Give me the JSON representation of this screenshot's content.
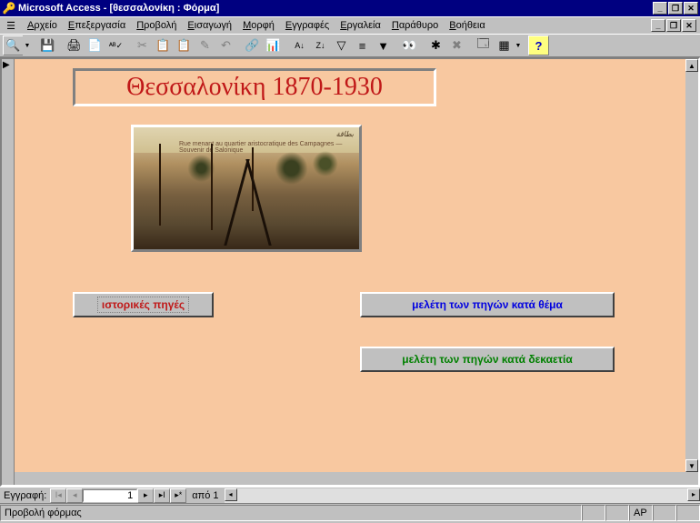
{
  "titlebar": {
    "app": "Microsoft Access",
    "doc": "[θεσσαλονίκη : Φόρμα]"
  },
  "menus": {
    "file": "Αρχείο",
    "edit": "Επεξεργασία",
    "view": "Προβολή",
    "insert": "Εισαγωγή",
    "format": "Μορφή",
    "records": "Εγγραφές",
    "tools": "Εργαλεία",
    "window": "Παράθυρο",
    "help": "Βοήθεια"
  },
  "form": {
    "heading": "Θεσσαλονίκη 1870-1930",
    "image_caption_top": "بطاقة",
    "image_caption_mid": "Rue menant au quartier aristocratique des Campagnes — Souvenir de Salonique",
    "btn_sources": "ιστορικές πηγές",
    "btn_theme": "μελέτη των πηγών κατά θέμα",
    "btn_decade": "μελέτη των πηγών κατά δεκαετία"
  },
  "recordnav": {
    "label": "Εγγραφή:",
    "current": "1",
    "of_text": "από 1"
  },
  "status": {
    "text": "Προβολή φόρμας",
    "indicator": "ΑΡ"
  },
  "icons": {
    "view": "🔍",
    "save": "💾",
    "print": "🖨",
    "preview": "📄",
    "spell": "ᴬᴮ✓",
    "cut": "✂",
    "copy": "📋",
    "paste": "📋",
    "fmt": "✎",
    "undo": "↶",
    "link": "🔗",
    "t1": "📊",
    "t2": "≡",
    "new": "✱",
    "del": "✖",
    "sort1": "A↓",
    "sort2": "Z↓",
    "filter1": "▽",
    "filter2": "▼",
    "find": "👀",
    "go": "▸",
    "stop": "✖",
    "db": "🗔",
    "props": "▦",
    "help": "?"
  }
}
